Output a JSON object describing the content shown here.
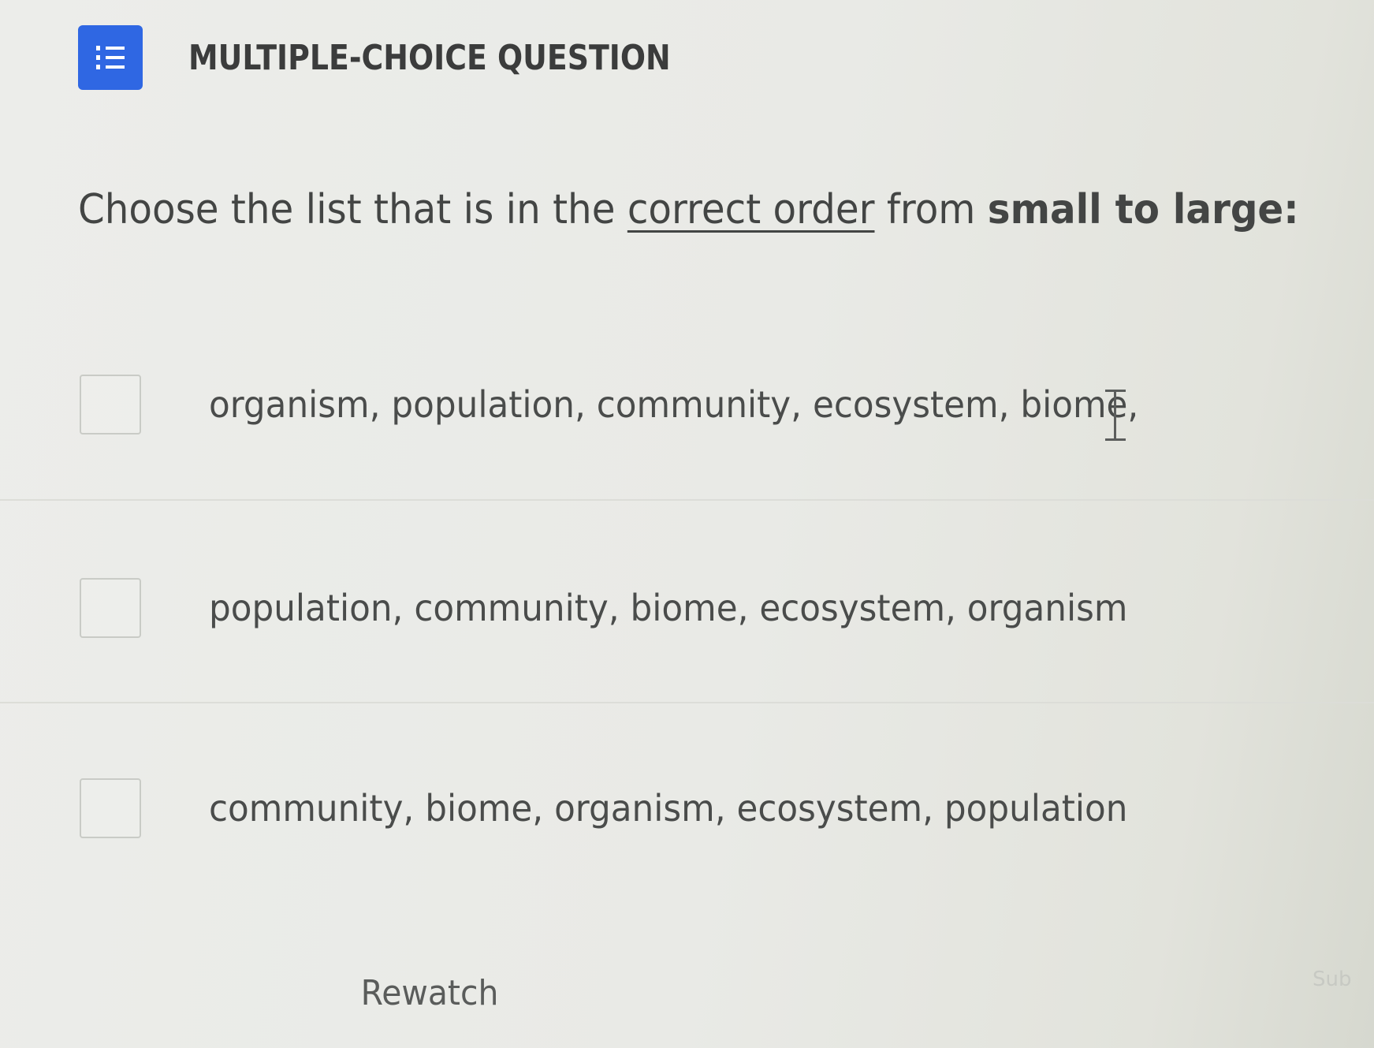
{
  "header": {
    "icon": "numbered-list-icon",
    "icon_color": "#2f67e3",
    "type_label": "MULTIPLE-CHOICE QUESTION"
  },
  "prompt": {
    "part1": "Choose the list that is in the ",
    "underlined": "correct order",
    "part2": " from ",
    "bold": "small to large:"
  },
  "options": [
    {
      "text": "organism, population, community, ecosystem, biome,",
      "checked": false
    },
    {
      "text": "population, community, biome, ecosystem, organism",
      "checked": false
    },
    {
      "text": "community, biome, organism, ecosystem, population",
      "checked": false
    }
  ],
  "footer": {
    "rewatch_label": "Rewatch",
    "submit_label": "Sub"
  }
}
